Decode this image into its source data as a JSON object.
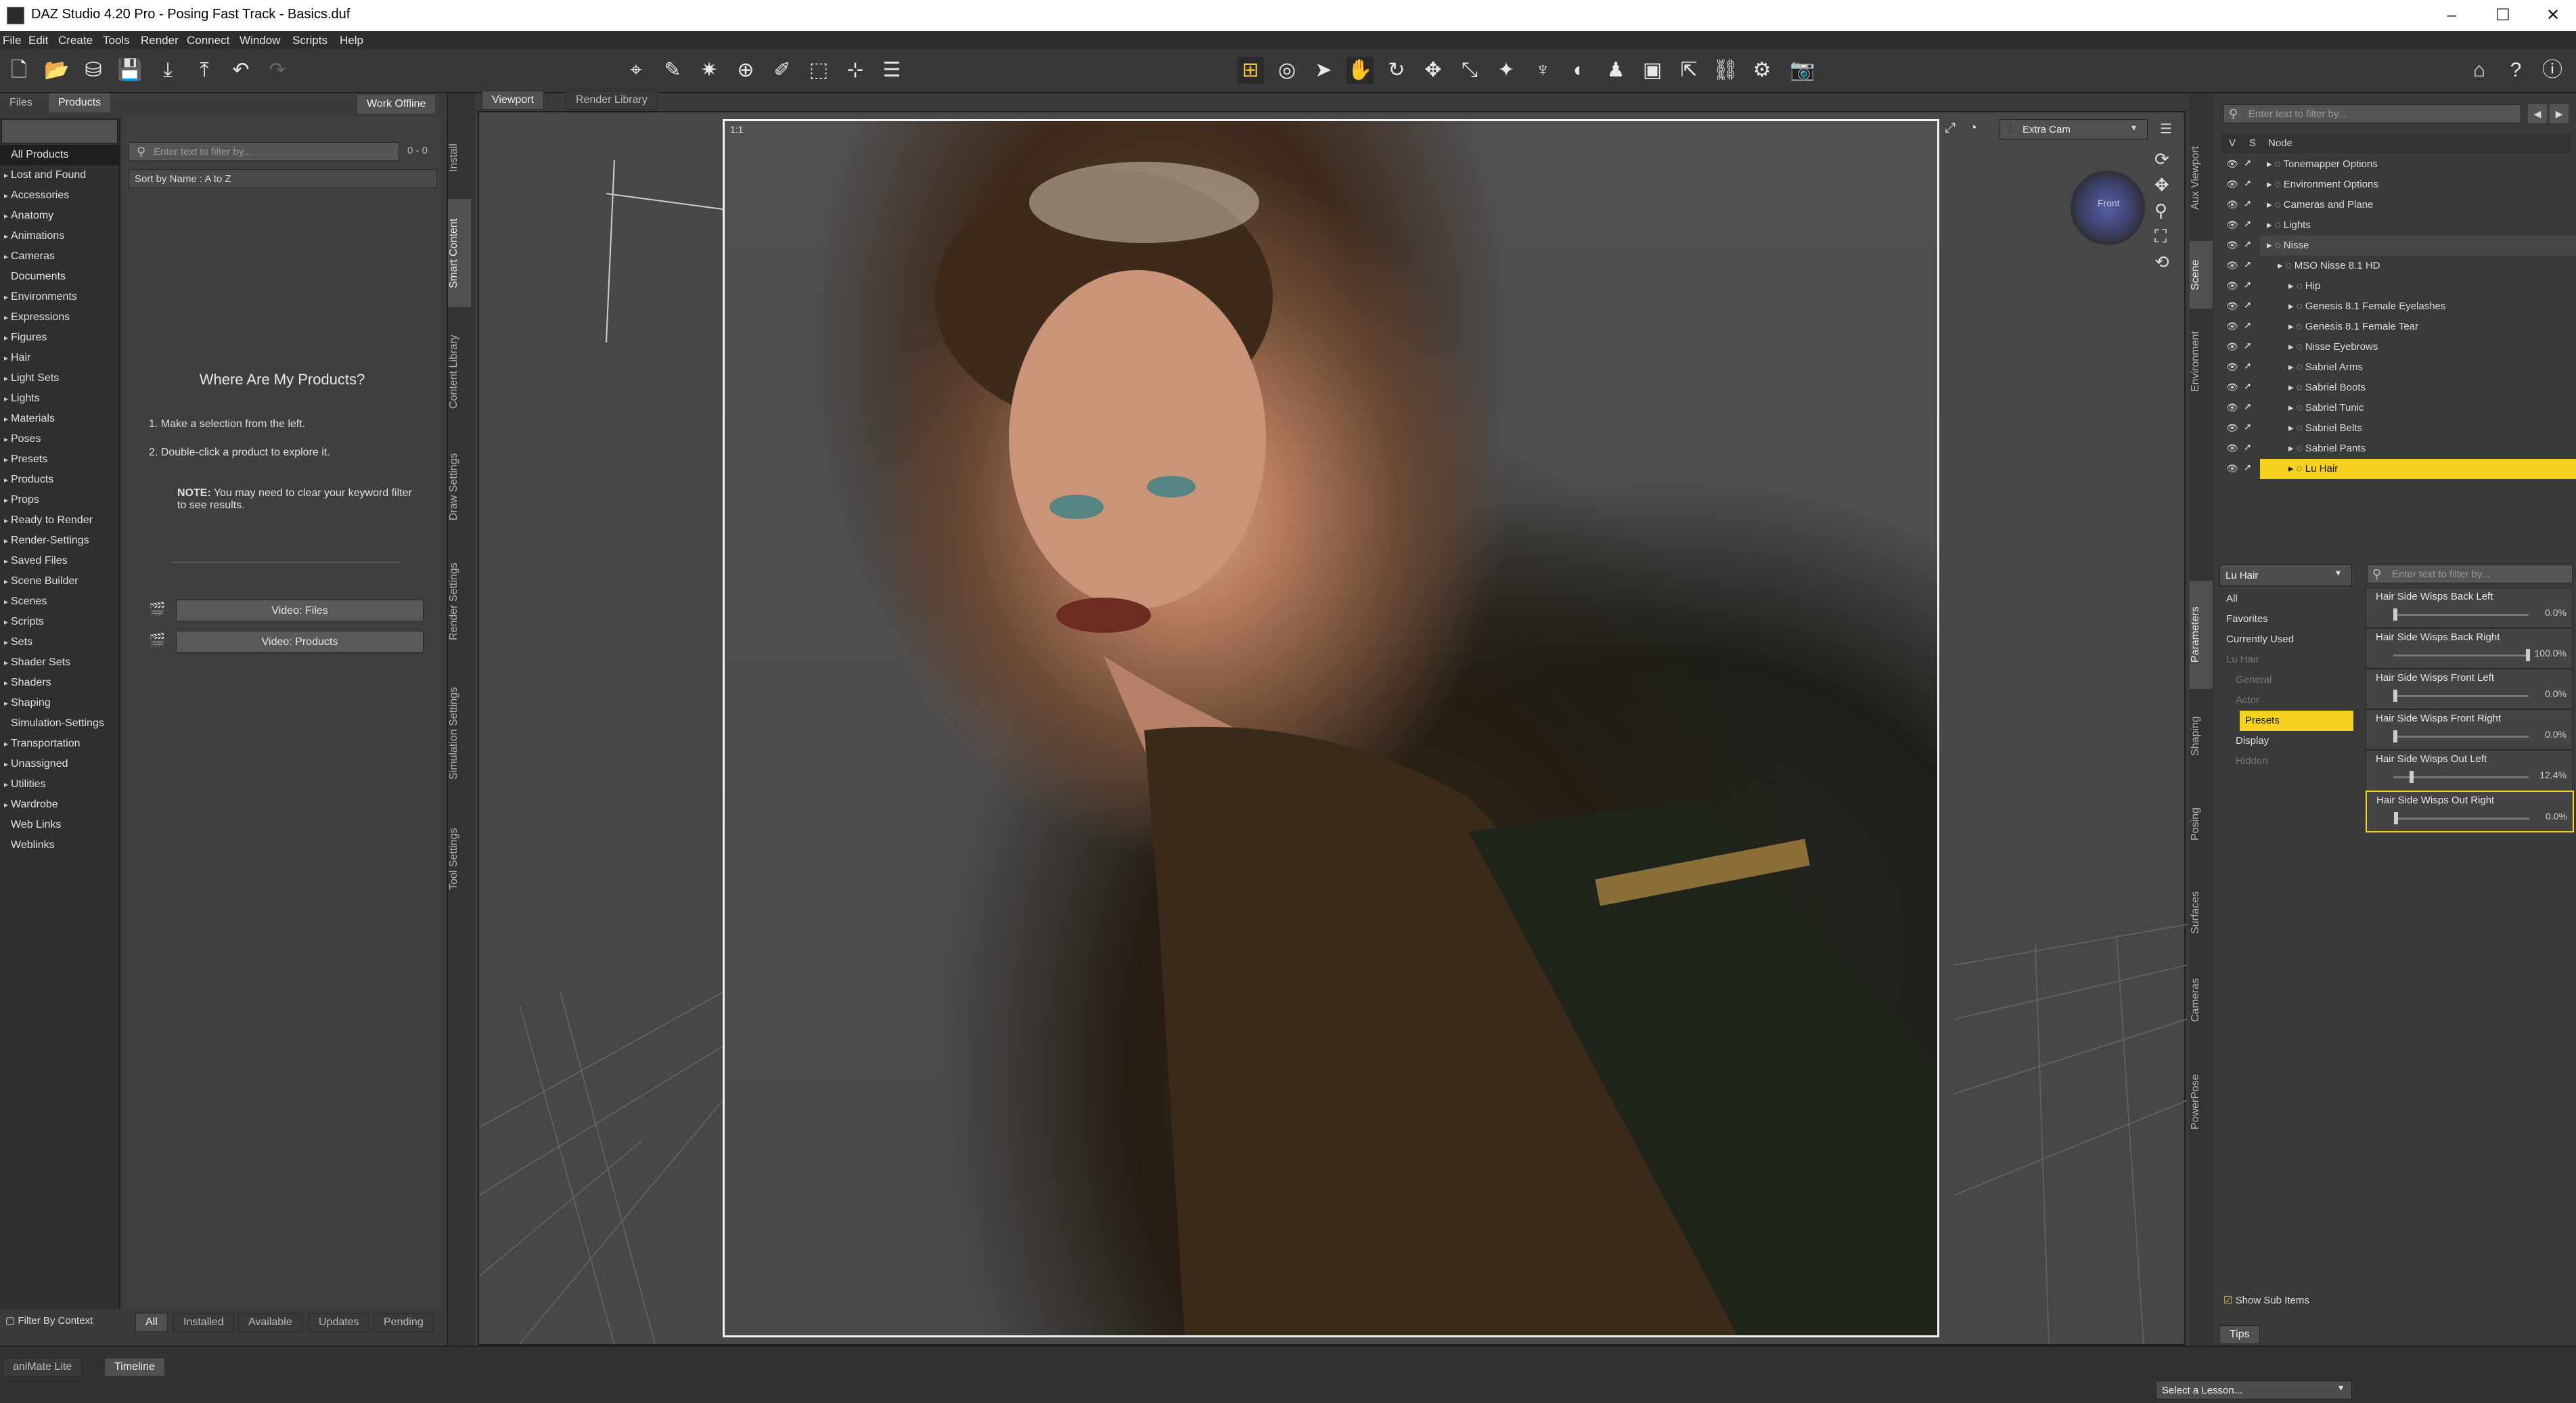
{
  "window": {
    "title": "DAZ Studio 4.20 Pro - Posing Fast Track - Basics.duf"
  },
  "window_controls": {
    "minimize": "–",
    "maximize": "☐",
    "close": "✕"
  },
  "menu": [
    "File",
    "Edit",
    "Create",
    "Tools",
    "Render",
    "Connect",
    "Window",
    "Scripts",
    "Help"
  ],
  "left_panel": {
    "tabs": [
      "Files",
      "Products"
    ],
    "work_offline": "Work Offline",
    "filter_placeholder": "Enter text to filter by...",
    "filter_count": "0 - 0",
    "sort": "Sort by Name : A to Z",
    "categories": [
      {
        "label": "All Products",
        "arrow": false,
        "selected": true
      },
      {
        "label": "Lost and Found",
        "arrow": true
      },
      {
        "label": "Accessories",
        "arrow": true
      },
      {
        "label": "Anatomy",
        "arrow": true
      },
      {
        "label": "Animations",
        "arrow": true
      },
      {
        "label": "Cameras",
        "arrow": true
      },
      {
        "label": "Documents",
        "arrow": false
      },
      {
        "label": "Environments",
        "arrow": true
      },
      {
        "label": "Expressions",
        "arrow": true
      },
      {
        "label": "Figures",
        "arrow": true
      },
      {
        "label": "Hair",
        "arrow": true
      },
      {
        "label": "Light Sets",
        "arrow": true
      },
      {
        "label": "Lights",
        "arrow": true
      },
      {
        "label": "Materials",
        "arrow": true
      },
      {
        "label": "Poses",
        "arrow": true
      },
      {
        "label": "Presets",
        "arrow": true
      },
      {
        "label": "Products",
        "arrow": true
      },
      {
        "label": "Props",
        "arrow": true
      },
      {
        "label": "Ready to Render",
        "arrow": true
      },
      {
        "label": "Render-Settings",
        "arrow": true
      },
      {
        "label": "Saved Files",
        "arrow": true
      },
      {
        "label": "Scene Builder",
        "arrow": true
      },
      {
        "label": "Scenes",
        "arrow": true
      },
      {
        "label": "Scripts",
        "arrow": true
      },
      {
        "label": "Sets",
        "arrow": true
      },
      {
        "label": "Shader Sets",
        "arrow": true
      },
      {
        "label": "Shaders",
        "arrow": true
      },
      {
        "label": "Shaping",
        "arrow": true
      },
      {
        "label": "Simulation-Settings",
        "arrow": false
      },
      {
        "label": "Transportation",
        "arrow": true
      },
      {
        "label": "Unassigned",
        "arrow": true
      },
      {
        "label": "Utilities",
        "arrow": true
      },
      {
        "label": "Wardrobe",
        "arrow": true
      },
      {
        "label": "Web Links",
        "arrow": false
      },
      {
        "label": "Weblinks",
        "arrow": false
      }
    ],
    "help_title": "Where Are My Products?",
    "step1_num": "1.",
    "step1": "Make a selection from the left.",
    "step2_num": "2.",
    "step2": "Double-click a product to explore it.",
    "note_label": "NOTE:",
    "note": "You may need to clear your keyword filter to see results.",
    "video_files": "Video: Files",
    "video_products": "Video: Products",
    "filter_by_context": "Filter By Context",
    "bottom_tabs": [
      "All",
      "Installed",
      "Available",
      "Updates",
      "Pending"
    ],
    "side_tabs": [
      "Install",
      "Smart Content",
      "Content Library",
      "Draw Settings",
      "Render Settings",
      "Simulation Settings",
      "Tool Settings"
    ]
  },
  "viewport": {
    "tabs": [
      "Viewport",
      "Render Library"
    ],
    "aspect_label": "1:1",
    "camera": "Extra Cam",
    "cube_label": "Front"
  },
  "scene": {
    "filter_placeholder": "Enter text to filter by...",
    "col_v": "V",
    "col_s": "S",
    "col_node": "Node",
    "side_tabs": [
      "Aux Viewport",
      "Scene",
      "Environment"
    ],
    "nodes": [
      {
        "label": "Tonemapper Options",
        "indent": 0
      },
      {
        "label": "Environment Options",
        "indent": 0
      },
      {
        "label": "Cameras and Plane",
        "indent": 0
      },
      {
        "label": "Lights",
        "indent": 0
      },
      {
        "label": "Nisse",
        "indent": 0
      },
      {
        "label": "MSO Nisse 8.1 HD",
        "indent": 1
      },
      {
        "label": "Hip",
        "indent": 2
      },
      {
        "label": "Genesis 8.1 Female Eyelashes",
        "indent": 2
      },
      {
        "label": "Genesis 8.1 Female Tear",
        "indent": 2
      },
      {
        "label": "Nisse Eyebrows",
        "indent": 2
      },
      {
        "label": "Sabriel Arms",
        "indent": 2
      },
      {
        "label": "Sabriel Boots",
        "indent": 2
      },
      {
        "label": "Sabriel Tunic",
        "indent": 2
      },
      {
        "label": "Sabriel Belts",
        "indent": 2
      },
      {
        "label": "Sabriel Pants",
        "indent": 2
      },
      {
        "label": "Lu Hair",
        "indent": 2,
        "selected": true
      }
    ]
  },
  "parameters": {
    "node_select": "Lu Hair",
    "filter_placeholder": "Enter text to filter by...",
    "side_tabs": [
      "Parameters",
      "Shaping",
      "Posing",
      "Surfaces",
      "Cameras",
      "PowerPose"
    ],
    "groups": [
      "All",
      "Favorites",
      "Currently Used",
      "Lu Hair",
      "General",
      "Actor",
      "Presets",
      "Display",
      "Hidden"
    ],
    "sliders": [
      {
        "label": "Hair Side Wisps Back Left",
        "value": "0.0%",
        "fraction": 0.0
      },
      {
        "label": "Hair Side Wisps Back Right",
        "value": "100.0%",
        "fraction": 1.0
      },
      {
        "label": "Hair Side Wisps Front Left",
        "value": "0.0%",
        "fraction": 0.0
      },
      {
        "label": "Hair Side Wisps Front Right",
        "value": "0.0%",
        "fraction": 0.0
      },
      {
        "label": "Hair Side Wisps Out Left",
        "value": "12.4%",
        "fraction": 0.124
      },
      {
        "label": "Hair Side Wisps Out Right",
        "value": "0.0%",
        "fraction": 0.0
      }
    ],
    "show_sub_items": "Show Sub Items",
    "tips": "Tips"
  },
  "status": {
    "tabs": [
      "aniMate Lite",
      "Timeline"
    ],
    "lesson": "Select a Lesson..."
  },
  "colors": {
    "accent": "#f5d21f",
    "selection": "#f5d21f",
    "panel": "#3a3a3a"
  }
}
